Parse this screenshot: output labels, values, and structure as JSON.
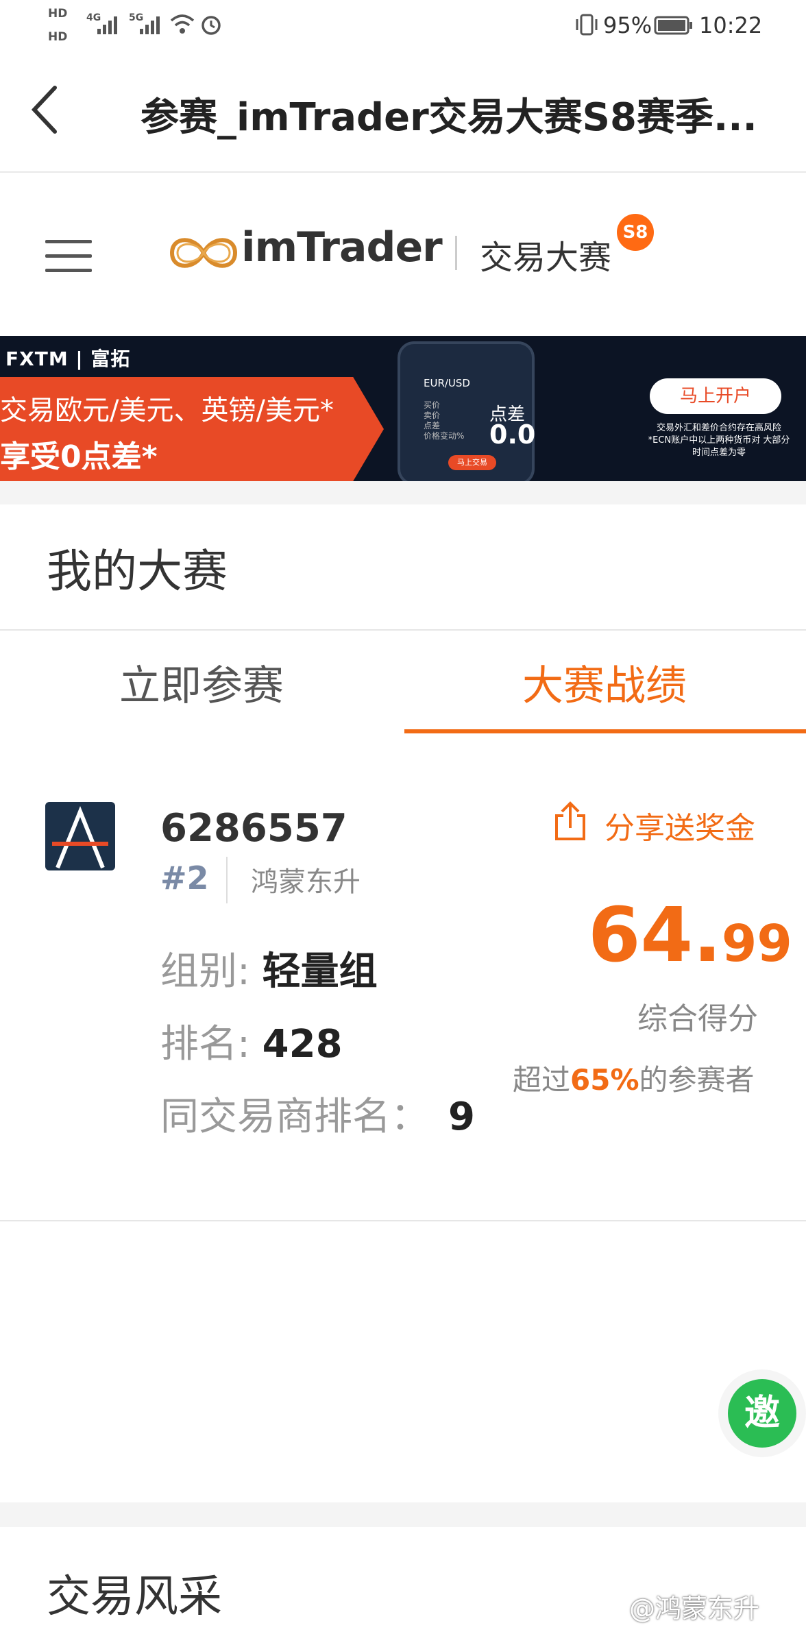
{
  "status_bar": {
    "hd1": "HD",
    "hd2": "HD",
    "sim1_tag": "4G",
    "sim2_tag": "5G",
    "battery": "95%",
    "time": "10:22"
  },
  "app_bar": {
    "title": "参赛_imTrader交易大赛S8赛季..."
  },
  "site_header": {
    "logo_text": "imTrader",
    "contest_label": "交易大赛",
    "season_badge": "S8"
  },
  "banner": {
    "brand": "FXTM | 富拓",
    "line1": "交易欧元/美元、英镑/美元*",
    "line2": "享受0点差*",
    "pair": "EUR/USD",
    "phone_list": [
      "买价",
      "卖价",
      "点差",
      "价格变动%"
    ],
    "phone_button": "马上交易",
    "spread_label": "点差",
    "spread_value": "0.0",
    "cta": "马上开户",
    "risk_note": "交易外汇和差价合约存在高风险 *ECN账户中以上两种货币对 大部分时间点差为零"
  },
  "section": {
    "title": "我的大赛"
  },
  "tabs": [
    {
      "label": "立即参赛",
      "active": false
    },
    {
      "label": "大赛战绩",
      "active": true
    }
  ],
  "record": {
    "user_id": "6286557",
    "rank_tag": "#2",
    "nickname": "鸿蒙东升",
    "share_label": "分享送奖金",
    "score_int": "64.",
    "score_dec": "99",
    "score_label": "综合得分",
    "beat_prefix": "超过",
    "beat_pct": "65%",
    "beat_suffix": "的参赛者",
    "group_label": "组别: ",
    "group_value": "轻量组",
    "rank_label": "排名: ",
    "rank_value": "428",
    "broker_rank_label": "同交易商排名：",
    "broker_rank_value": "9"
  },
  "invite_button": "邀",
  "section2": {
    "title": "交易风采"
  },
  "watermark": "@鸿蒙东升",
  "colors": {
    "accent": "#f26b15",
    "invite_green": "#2bbd54",
    "banner_red": "#e84a26"
  }
}
